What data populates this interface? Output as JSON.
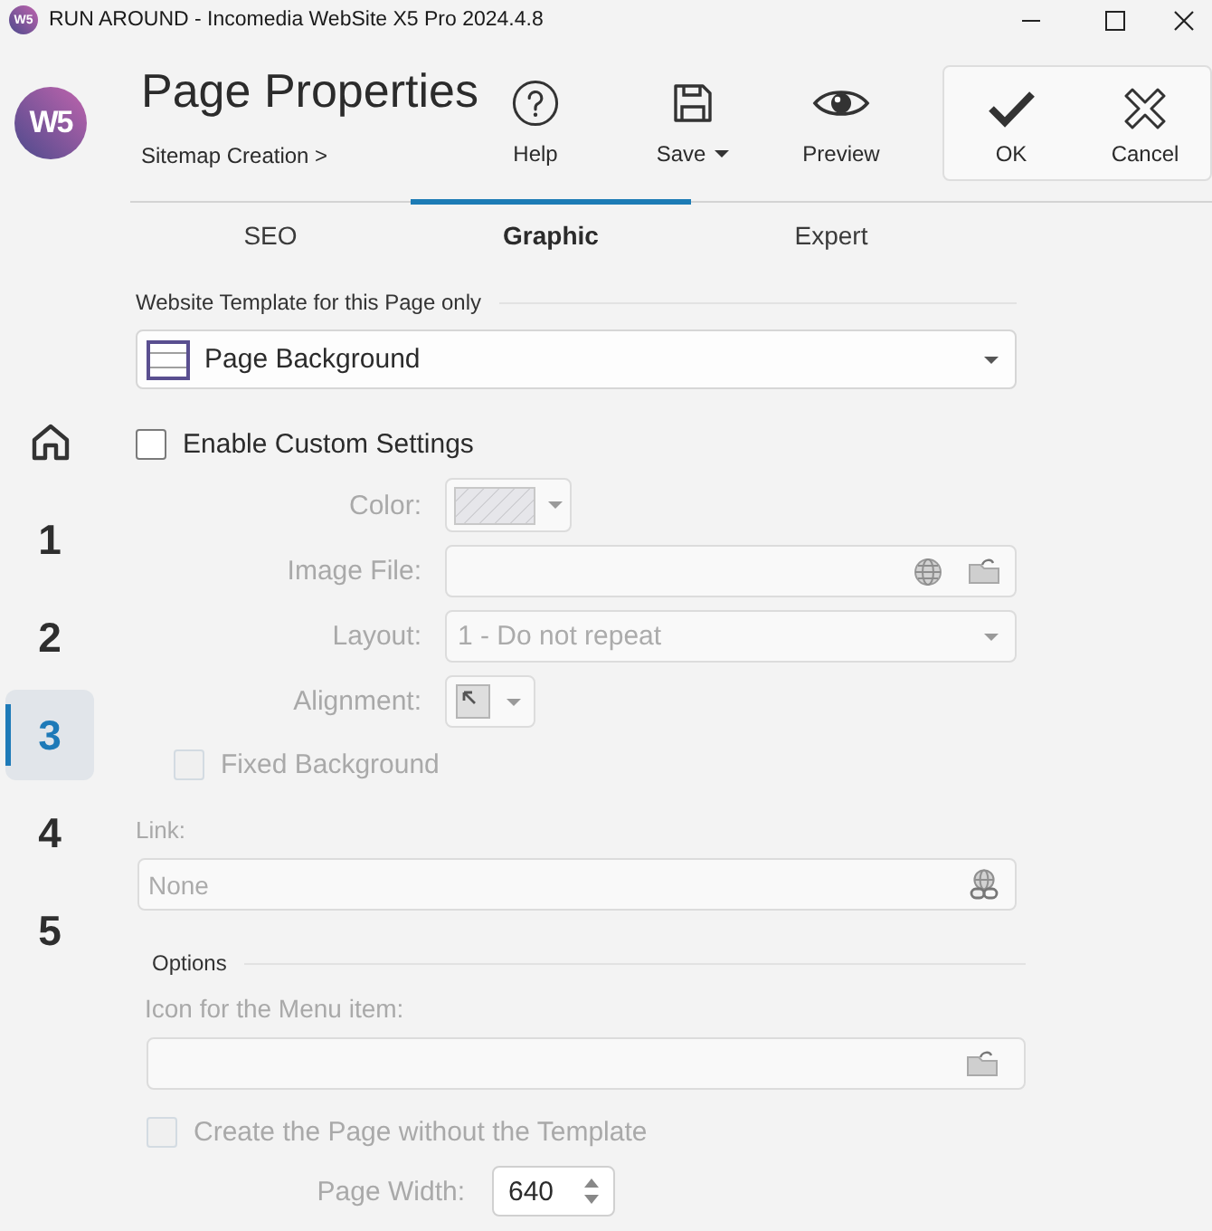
{
  "window": {
    "app_mark": "W5",
    "title": "RUN AROUND - Incomedia WebSite X5 Pro 2024.4.8"
  },
  "header": {
    "logo_mark": "W5",
    "title": "Page Properties",
    "breadcrumb": "Sitemap Creation >",
    "tools": [
      {
        "kind": "help",
        "label": "Help"
      },
      {
        "kind": "save",
        "label": "Save",
        "has_menu": true
      },
      {
        "kind": "preview",
        "label": "Preview"
      }
    ],
    "actions": [
      {
        "kind": "ok",
        "label": "OK"
      },
      {
        "kind": "cancel",
        "label": "Cancel"
      }
    ]
  },
  "sidebar": {
    "items": [
      {
        "kind": "home",
        "selected": false
      },
      {
        "kind": "page",
        "label": "1",
        "selected": false
      },
      {
        "kind": "page",
        "label": "2",
        "selected": false
      },
      {
        "kind": "page",
        "label": "3",
        "selected": true
      },
      {
        "kind": "page",
        "label": "4",
        "selected": false
      },
      {
        "kind": "page",
        "label": "5",
        "selected": false
      }
    ]
  },
  "tabs": [
    {
      "label": "SEO",
      "selected": false
    },
    {
      "label": "Graphic",
      "selected": true
    },
    {
      "label": "Expert",
      "selected": false
    }
  ],
  "template": {
    "heading": "Website Template for this Page only",
    "select": {
      "value": "Page Background"
    }
  },
  "custom_settings": {
    "label": "Enable Custom Settings",
    "checked": false
  },
  "fields": [
    {
      "kind": "color",
      "label": "Color:",
      "disabled": true
    },
    {
      "kind": "file",
      "label": "Image File:",
      "disabled": true
    },
    {
      "kind": "select",
      "label": "Layout:",
      "value": "1 - Do not repeat",
      "disabled": true
    },
    {
      "kind": "alignment",
      "label": "Alignment:",
      "disabled": true
    }
  ],
  "fixed_background": {
    "label": "Fixed Background",
    "checked": false,
    "disabled": true
  },
  "link": {
    "label": "Link:",
    "value": "None",
    "disabled": true
  },
  "options": {
    "heading": "Options",
    "menu_icon": {
      "label": "Icon for the Menu item:",
      "disabled": true
    },
    "no_template": {
      "label": "Create the Page without the Template",
      "checked": false,
      "disabled": true
    },
    "page_width": {
      "label": "Page Width:",
      "value": "640"
    }
  }
}
